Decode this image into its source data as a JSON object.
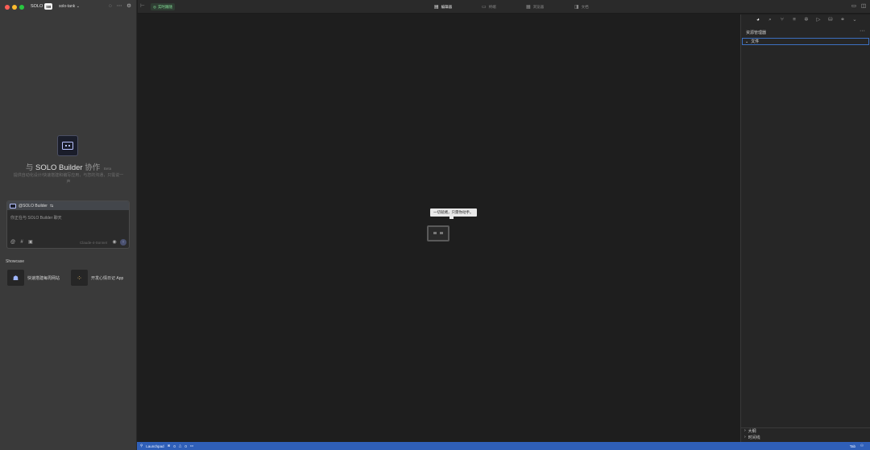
{
  "window": {
    "traffic_lights": {
      "close": "#ff5f57",
      "minimize": "#febc2e",
      "maximize": "#28c840"
    },
    "brand": "SOLO",
    "brand_badge": "SB",
    "project": "solo-tank",
    "project_chevron": "⌄"
  },
  "left": {
    "heading_prefix": "与",
    "heading_main": "SOLO Builder",
    "heading_suffix": "协作",
    "heading_beta": "Beta",
    "subtitle": "提供自动化设计/快速搭建和编写应用，与您的沟通，只需说一声",
    "chat": {
      "header": "@SOLO Builder",
      "header_icon": "⇆",
      "placeholder": "你正在与 SOLO Builder 聊天",
      "mention_icon": "@",
      "hash_icon": "#",
      "image_icon": "▣",
      "model": "Claude-4-Sonnet",
      "mic_icon": "🎙",
      "send_icon": "↑"
    },
    "showcase": {
      "title": "Showcase",
      "items": [
        {
          "label": "快速搭建每周网站",
          "icon": "☗"
        },
        {
          "label": "开发心情日记 App",
          "icon": "⁘"
        }
      ]
    }
  },
  "topbar": {
    "realtime": "实时跟随",
    "tabs": [
      {
        "label": "编辑器",
        "icon": "▤",
        "active": true
      },
      {
        "label": "终端",
        "icon": "▭",
        "active": false
      },
      {
        "label": "浏览器",
        "icon": "▦",
        "active": false
      },
      {
        "label": "文档",
        "icon": "◨",
        "active": false
      }
    ]
  },
  "center": {
    "tooltip": "一切就绪，只需你动手。"
  },
  "right": {
    "explorer_title": "资源管理器",
    "more": "···",
    "files_label": "文件",
    "outline_label": "大纲",
    "timeline_label": "时间线",
    "chevron_right": "›",
    "chevron_down": "⌄"
  },
  "statusbar": {
    "launchpad": "Launchpad",
    "errors": "0",
    "warnings": "0",
    "tab_label": "Tab"
  }
}
